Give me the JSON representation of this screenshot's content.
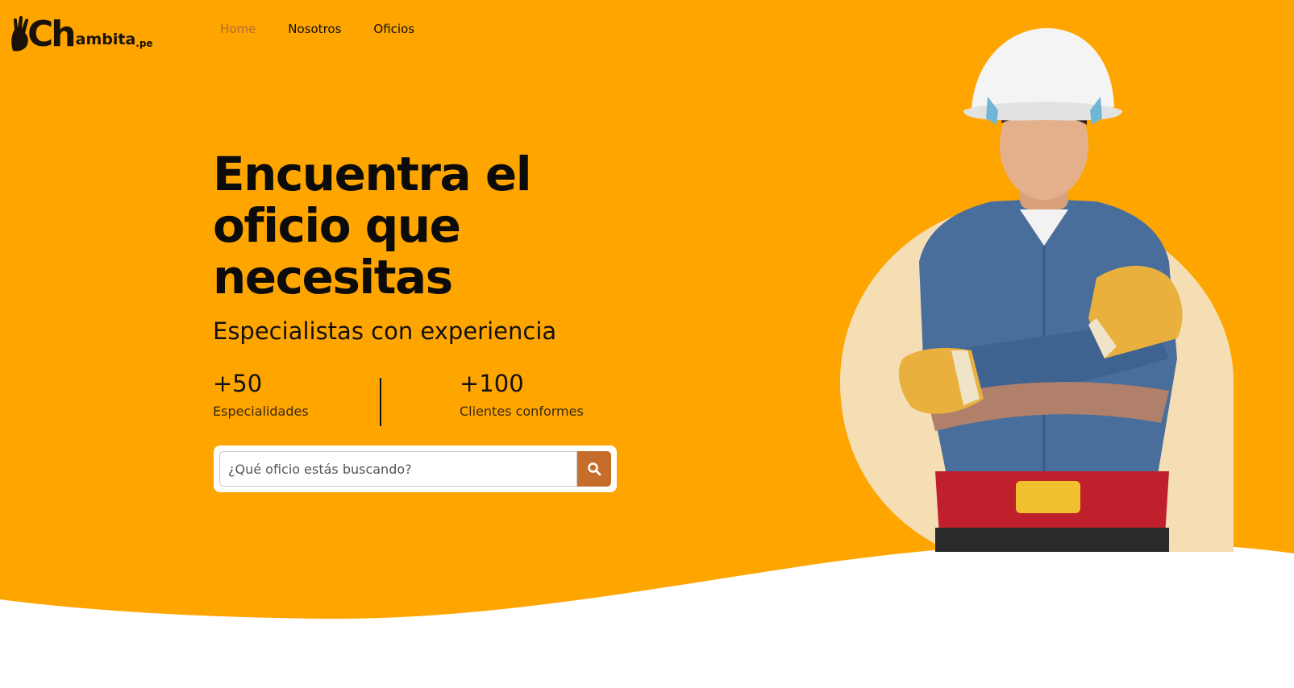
{
  "brand": {
    "logo_ch": "Ch",
    "logo_text": "ambita",
    "logo_suffix": ".pe",
    "logo_icon": "waving-hand-icon"
  },
  "nav": {
    "items": [
      {
        "label": "Home",
        "active": true
      },
      {
        "label": "Nosotros",
        "active": false
      },
      {
        "label": "Oficios",
        "active": false
      }
    ]
  },
  "hero": {
    "title": "Encuentra el oficio que necesitas",
    "subtitle": "Especialistas con experiencia",
    "stats": [
      {
        "value": "+50",
        "label": "Especialidades"
      },
      {
        "value": "+100",
        "label": "Clientes conformes"
      }
    ],
    "search": {
      "placeholder": "¿Qué oficio estás buscando?",
      "value": "",
      "button_icon": "search-icon"
    },
    "image_subject": "construction-worker-photo"
  },
  "colors": {
    "hero_background": "#ffa500",
    "accent_button": "#c76d2c",
    "nav_active": "#b46a35",
    "text": "#0b0b0b",
    "arch_background": "#f5deb3"
  }
}
